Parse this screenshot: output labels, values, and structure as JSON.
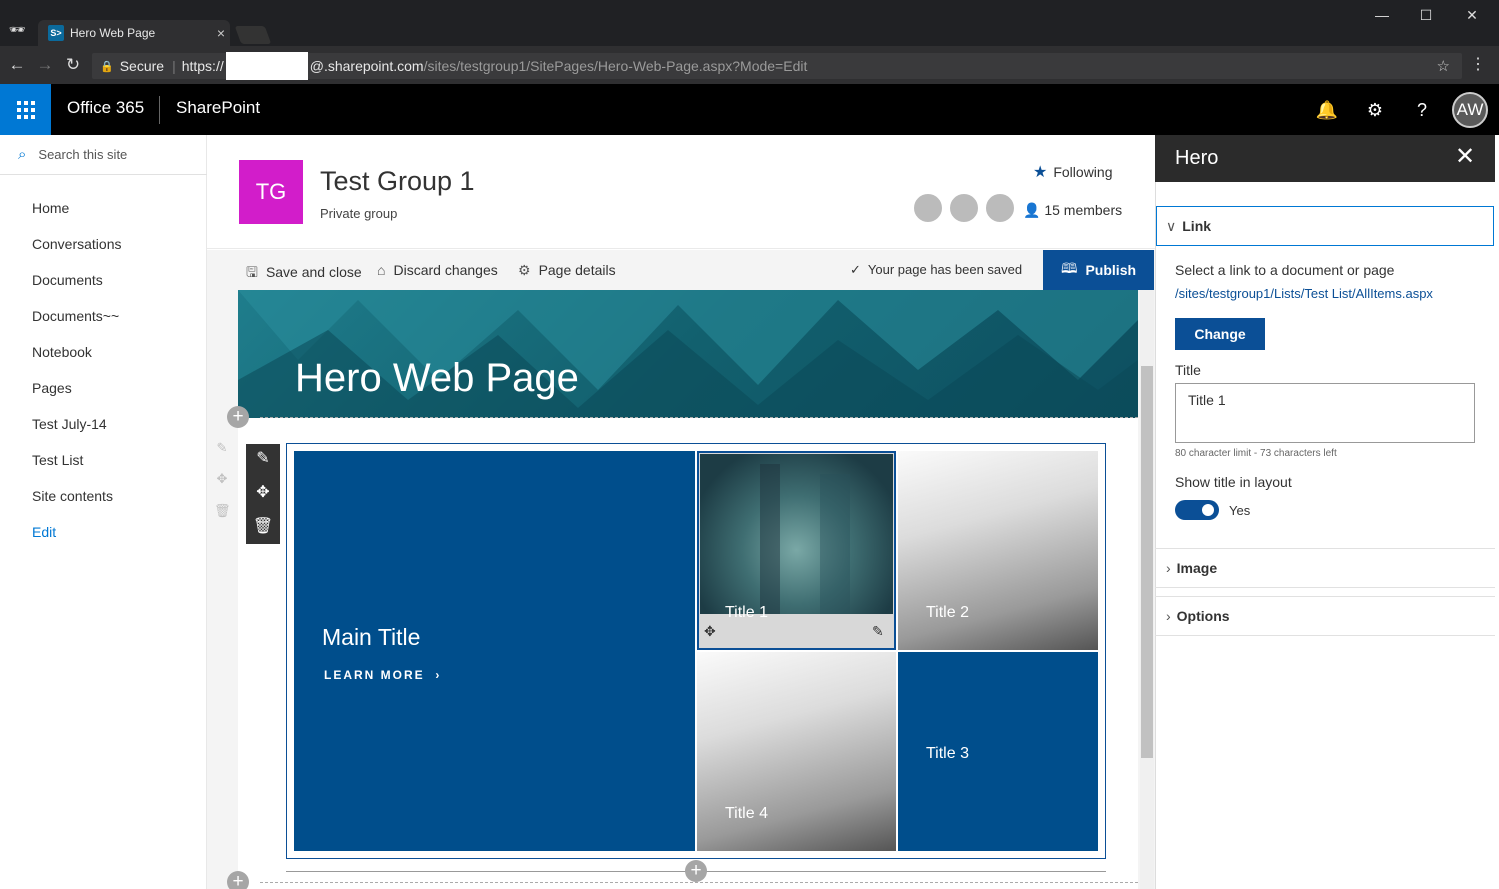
{
  "browser": {
    "tab_title": "Hero Web Page",
    "tab_favicon": "S>",
    "tab_close": "×",
    "secure_label": "Secure",
    "url_scheme": "https://",
    "url_host": "@.sharepoint.com",
    "url_path": "/sites/testgroup1/SitePages/Hero-Web-Page.aspx?Mode=Edit"
  },
  "suite": {
    "app_name": "Office 365",
    "product": "SharePoint",
    "avatar_initials": "AW"
  },
  "nav": {
    "search_placeholder": "Search this site",
    "items": [
      "Home",
      "Conversations",
      "Documents",
      "Documents~~",
      "Notebook",
      "Pages",
      "Test July-14",
      "Test List",
      "Site contents"
    ],
    "edit_label": "Edit"
  },
  "site": {
    "logo_initials": "TG",
    "logo_color": "#d21dca",
    "title": "Test Group 1",
    "subtitle": "Private group",
    "following_label": "Following",
    "members_label": "15 members"
  },
  "commands": {
    "save_close": "Save and close",
    "discard": "Discard changes",
    "page_details": "Page details",
    "saved_status": "Your page has been saved",
    "publish": "Publish"
  },
  "page": {
    "banner_title": "Hero Web Page"
  },
  "hero": {
    "main_title": "Main Title",
    "learn_more": "LEARN MORE",
    "tiles": [
      "Title 1",
      "Title 2",
      "Title 3",
      "Title 4"
    ],
    "accent": "#004e8c"
  },
  "panel": {
    "title": "Hero",
    "link_section": "Link",
    "link_desc": "Select a link to a document or page",
    "link_url": "/sites/testgroup1/Lists/Test List/AllItems.aspx",
    "change_button": "Change",
    "title_label": "Title",
    "title_value": "Title 1",
    "char_limit": "80 character limit - 73 characters left",
    "show_title_label": "Show title in layout",
    "toggle_value": "Yes",
    "image_section": "Image",
    "options_section": "Options"
  }
}
